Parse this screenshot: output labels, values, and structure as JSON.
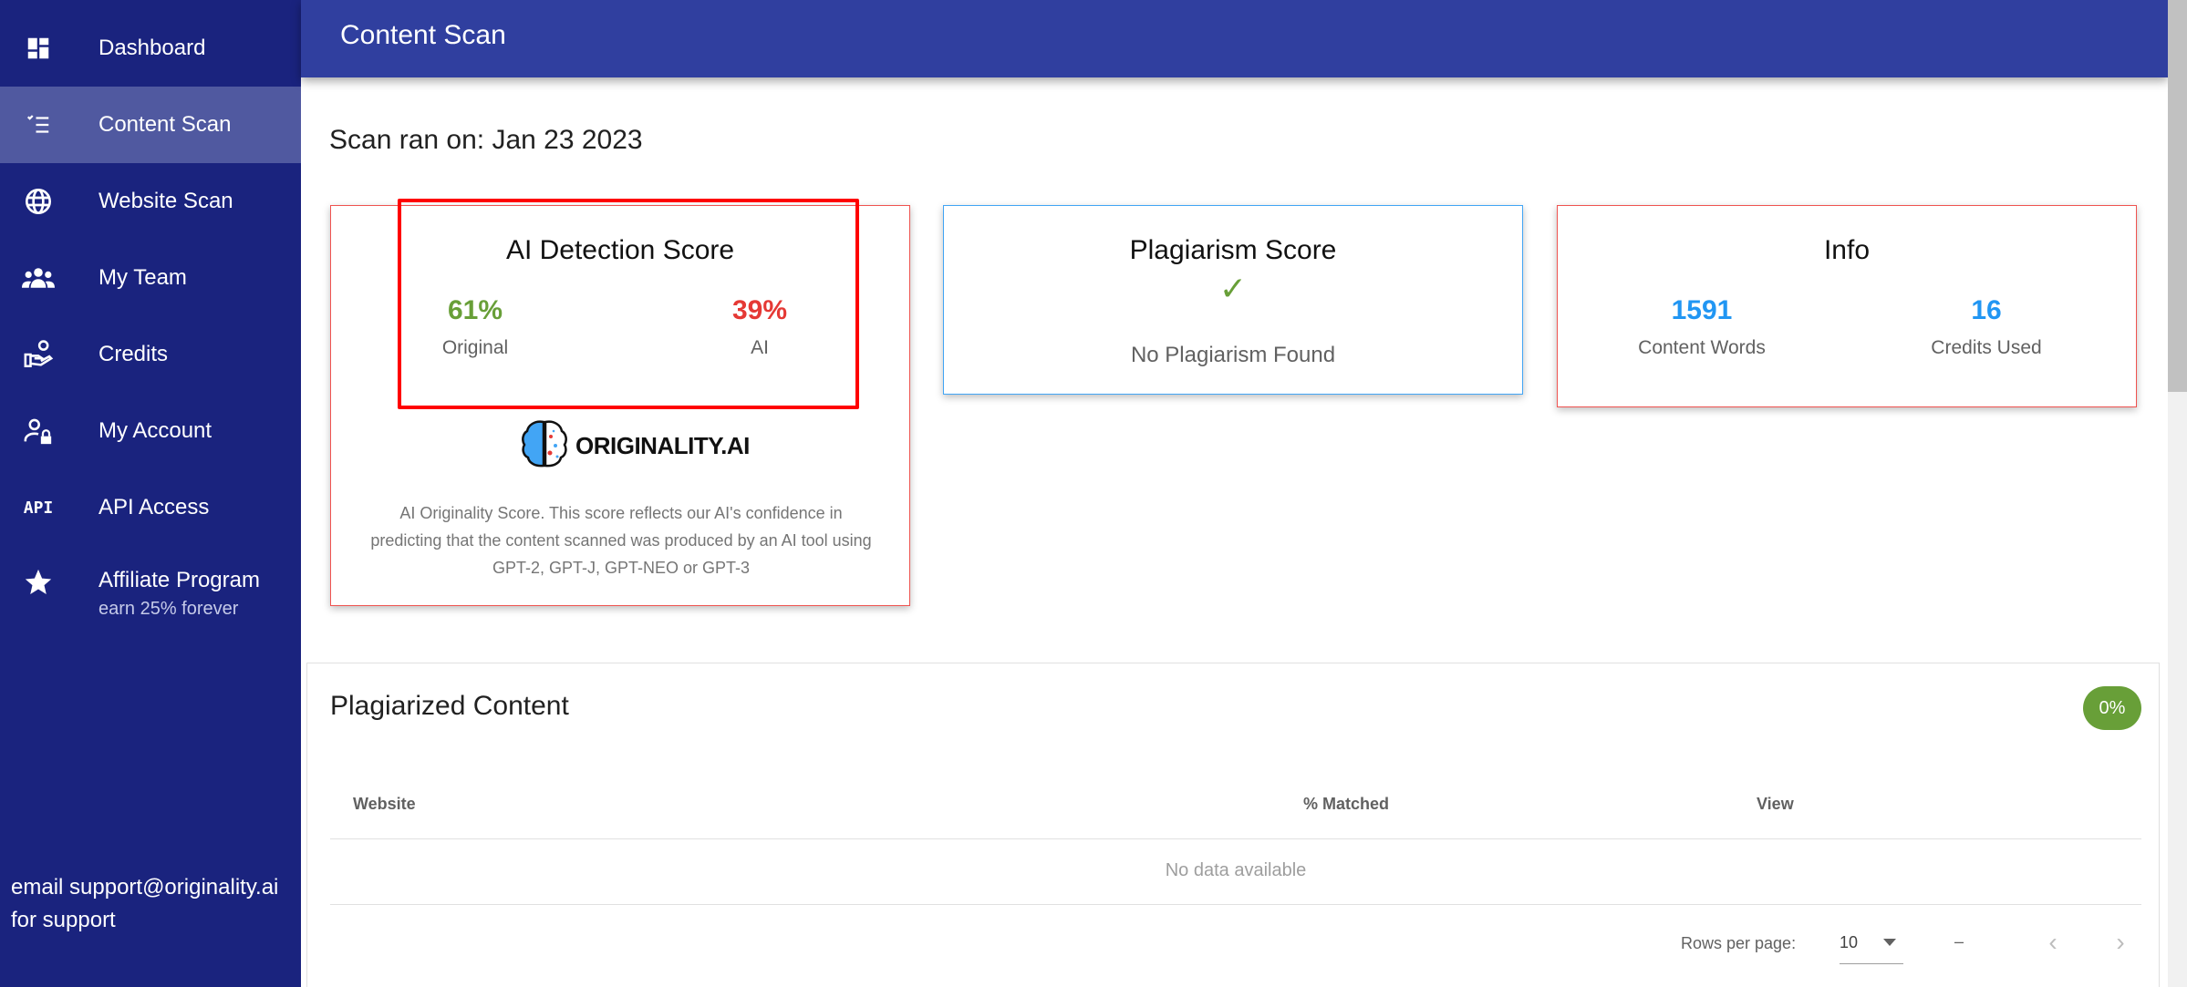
{
  "sidebar": {
    "items": [
      {
        "label": "Dashboard",
        "icon": "dashboard-icon"
      },
      {
        "label": "Content Scan",
        "icon": "checklist-icon",
        "active": true
      },
      {
        "label": "Website Scan",
        "icon": "globe-icon"
      },
      {
        "label": "My Team",
        "icon": "team-icon"
      },
      {
        "label": "Credits",
        "icon": "credits-hand-icon"
      },
      {
        "label": "My Account",
        "icon": "account-lock-icon"
      },
      {
        "label": "API Access",
        "icon": "api-icon",
        "icon_text": "API"
      },
      {
        "label": "Affiliate Program",
        "sublabel": "earn 25% forever",
        "icon": "star-icon"
      }
    ],
    "support_text": "email support@originality.ai for support"
  },
  "header": {
    "title": "Content Scan"
  },
  "scan": {
    "date_label": "Scan ran on: Jan 23 2023"
  },
  "ai_card": {
    "title": "AI Detection Score",
    "original": {
      "value": "61%",
      "label": "Original"
    },
    "ai": {
      "value": "39%",
      "label": "AI"
    },
    "logo_text": "ORIGINALITY.AI",
    "description": "AI Originality Score. This score reflects our AI's confidence in predicting that the content scanned was produced by an AI tool using GPT-2, GPT-J, GPT-NEO or GPT-3"
  },
  "plagiarism_card": {
    "title": "Plagiarism Score",
    "check_glyph": "✓",
    "status": "No Plagiarism Found"
  },
  "info_card": {
    "title": "Info",
    "words": {
      "value": "1591",
      "label": "Content Words"
    },
    "credits": {
      "value": "16",
      "label": "Credits Used"
    }
  },
  "plagiarized_content": {
    "title": "Plagiarized Content",
    "badge": "0%",
    "columns": [
      "Website",
      "% Matched",
      "View"
    ],
    "rows": [],
    "empty_text": "No data available",
    "footer": {
      "rows_per_page_label": "Rows per page:",
      "rows_per_page_value": "10",
      "range": "–",
      "prev_glyph": "‹",
      "next_glyph": "›"
    }
  },
  "colors": {
    "sidebar": "#1a237e",
    "sidebar_active": "#5059a0",
    "header": "#303f9f",
    "original_green": "#689f38",
    "ai_red": "#e53935",
    "info_blue": "#2196f3",
    "highlight_red": "#ff0000"
  }
}
